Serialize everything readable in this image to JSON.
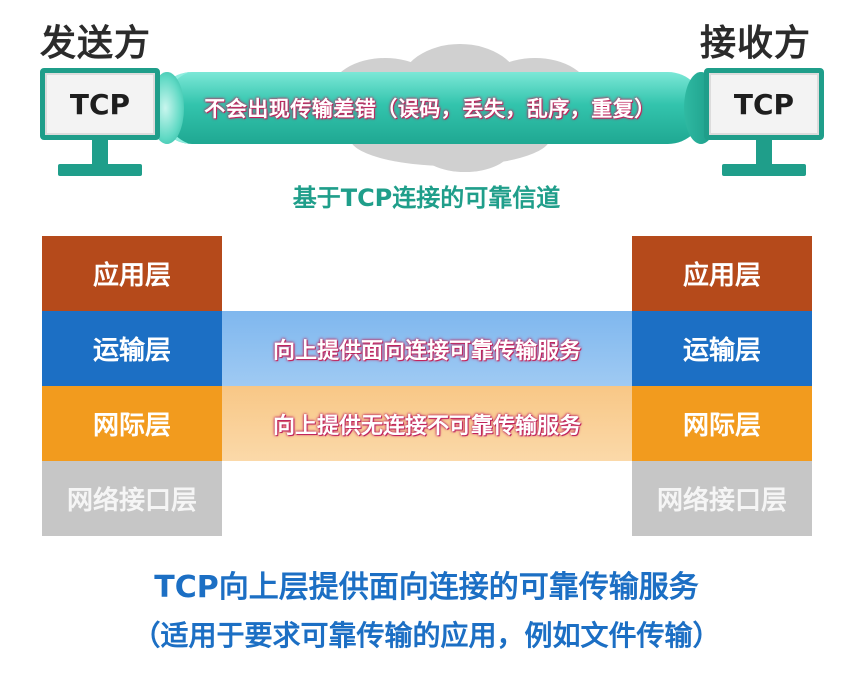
{
  "sender": {
    "label": "发送方",
    "screen_text": "TCP"
  },
  "receiver": {
    "label": "接收方",
    "screen_text": "TCP"
  },
  "pipe": {
    "text": "不会出现传输差错（误码，丢失，乱序，重复）"
  },
  "channel_caption": "基于TCP连接的可靠信道",
  "left_stack": [
    "应用层",
    "运输层",
    "网际层",
    "网络接口层"
  ],
  "right_stack": [
    "应用层",
    "运输层",
    "网际层",
    "网络接口层"
  ],
  "bands": {
    "transport": "向上提供面向连接可靠传输服务",
    "internet": "向上提供无连接不可靠传输服务"
  },
  "summary": {
    "line1": "TCP向上层提供面向连接的可靠传输服务",
    "line2": "（适用于要求可靠传输的应用，例如文件传输）"
  },
  "colors": {
    "teal": "#1f9e8a",
    "application": "#b54a1b",
    "transport": "#1c6fc4",
    "internet": "#f29b1e",
    "link": "#c6c6c6",
    "highlight_text_outline": "#c0265e"
  }
}
